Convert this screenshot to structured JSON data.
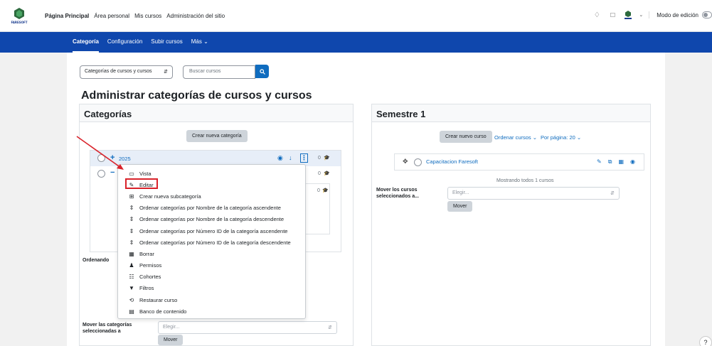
{
  "brand": {
    "logo_text": "FARESOFT"
  },
  "topnav": {
    "items": [
      "Página Principal",
      "Área personal",
      "Mis cursos",
      "Administración del sitio"
    ],
    "edit_mode_label": "Modo de edición"
  },
  "secondary_nav": {
    "items": [
      "Categoría",
      "Configuración",
      "Subir cursos",
      "Más ⌄"
    ]
  },
  "filters": {
    "view_select": "Categorías de cursos y cursos",
    "search_placeholder": "Buscar cursos"
  },
  "page_title": "Administrar categorías de cursos y cursos",
  "categories_panel": {
    "title": "Categorías",
    "create_button": "Crear nueva categoría",
    "rows": [
      {
        "name": "2025",
        "count": "0"
      },
      {
        "name": "",
        "count": "0"
      },
      {
        "name": "",
        "count": "0"
      }
    ],
    "sorting_label": "Ordenando",
    "move_label": "Mover las categorías seleccionadas a",
    "move_select": "Elegir...",
    "move_button": "Mover"
  },
  "context_menu": {
    "items": [
      {
        "icon": "view-icon",
        "glyph": "▭",
        "label": "Vista"
      },
      {
        "icon": "pencil-icon",
        "glyph": "✎",
        "label": "Editar"
      },
      {
        "icon": "sitemap-icon",
        "glyph": "⊞",
        "label": "Crear nueva subcategoría"
      },
      {
        "icon": "sort-icon",
        "glyph": "⇕",
        "label": "Ordenar categorías por Nombre de la categoría ascendente"
      },
      {
        "icon": "sort-icon",
        "glyph": "⇕",
        "label": "Ordenar categorías por Nombre de la categoría descendente"
      },
      {
        "icon": "sort-icon",
        "glyph": "⇕",
        "label": "Ordenar categorías por Número ID de la categoría ascendente"
      },
      {
        "icon": "sort-icon",
        "glyph": "⇕",
        "label": "Ordenar categorías por Número ID de la categoría descendente"
      },
      {
        "icon": "trash-icon",
        "glyph": "🗑",
        "label": "Borrar"
      },
      {
        "icon": "users-icon",
        "glyph": "👥",
        "label": "Permisos"
      },
      {
        "icon": "cohorts-icon",
        "glyph": "☷",
        "label": "Cohortes"
      },
      {
        "icon": "filter-icon",
        "glyph": "▼",
        "label": "Filtros"
      },
      {
        "icon": "restore-icon",
        "glyph": "⟲",
        "label": "Restaurar curso"
      },
      {
        "icon": "content-bank-icon",
        "glyph": "▤",
        "label": "Banco de contenido"
      }
    ]
  },
  "semester_panel": {
    "title": "Semestre 1",
    "create_button": "Crear nuevo curso",
    "sort_link": "Ordenar cursos ⌄",
    "per_page_link": "Por página: 20 ⌄",
    "course": "Capacitacion Faresoft",
    "showing_text": "Mostrando todos 1 cursos",
    "move_label": "Mover los cursos seleccionados a...",
    "move_select": "Elegir...",
    "move_button": "Mover"
  },
  "colors": {
    "brand_blue": "#0f47ad",
    "link_blue": "#0f6cbf",
    "annotation_red": "#d9222a"
  }
}
